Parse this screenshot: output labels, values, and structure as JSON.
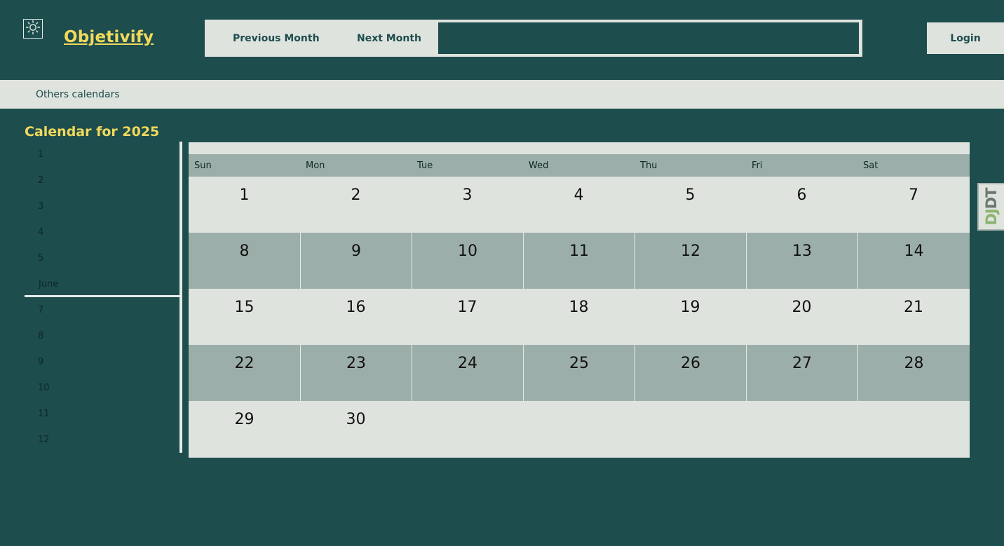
{
  "header": {
    "theme_toggle_icon": "sun-icon",
    "brand": "Objetivify",
    "prev_label": "Previous Month",
    "next_label": "Next Month",
    "search_value": "",
    "login_label": "Login"
  },
  "subnav": {
    "others_label": "Others calendars"
  },
  "sidebar": {
    "title": "Calendar for 2025",
    "months": [
      "1",
      "2",
      "3",
      "4",
      "5",
      "June",
      "7",
      "8",
      "9",
      "10",
      "11",
      "12"
    ],
    "active": "June"
  },
  "calendar": {
    "weekdays": [
      "Sun",
      "Mon",
      "Tue",
      "Wed",
      "Thu",
      "Fri",
      "Sat"
    ],
    "weeks": [
      [
        "1",
        "2",
        "3",
        "4",
        "5",
        "6",
        "7"
      ],
      [
        "8",
        "9",
        "10",
        "11",
        "12",
        "13",
        "14"
      ],
      [
        "15",
        "16",
        "17",
        "18",
        "19",
        "20",
        "21"
      ],
      [
        "22",
        "23",
        "24",
        "25",
        "26",
        "27",
        "28"
      ],
      [
        "29",
        "30",
        "",
        "",
        "",
        "",
        ""
      ]
    ]
  },
  "debug_toolbar": {
    "label_dj": "DJ",
    "label_dt": "DT"
  },
  "colors": {
    "background": "#1d4d4d",
    "accent": "#f1d95c",
    "panel": "#dfe3de",
    "stripe": "#9caea9",
    "djdt_green": "#8ab46e",
    "djdt_dark": "#6b7670"
  }
}
